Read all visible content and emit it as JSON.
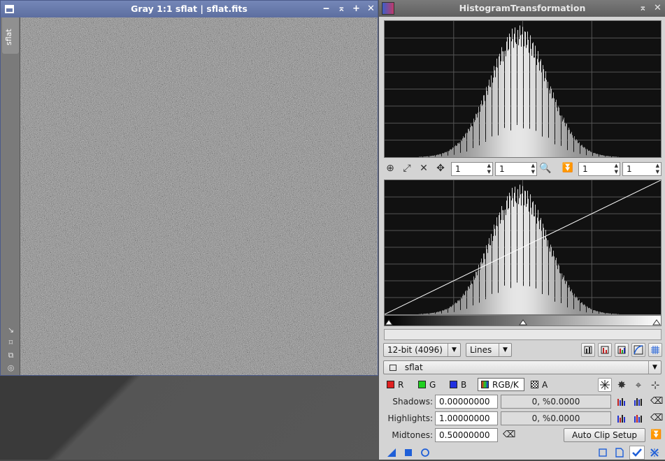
{
  "image_window": {
    "title": "Gray 1:1 sflat | sflat.fits",
    "side_tab_label": "sflat",
    "title_buttons": [
      "minimize",
      "shade",
      "maximize",
      "close"
    ],
    "side_icons": [
      "arrow-diag-icon",
      "fit-icon",
      "clone-icon",
      "mask-icon"
    ]
  },
  "histogram": {
    "title": "HistogramTransformation",
    "zoom_h_top": "1",
    "zoom_v_top": "1",
    "zoom_h_bottom": "1",
    "zoom_v_bottom": "1",
    "resolution": "12-bit (4096)",
    "graph_style": "Lines",
    "view": "sflat",
    "channels": {
      "r": "R",
      "g": "G",
      "b": "B",
      "rgbk": "RGB/K",
      "a": "A"
    },
    "shadows_label": "Shadows:",
    "shadows_value": "0.00000000",
    "shadows_clip": "0, %0.0000",
    "highlights_label": "Highlights:",
    "highlights_value": "1.00000000",
    "highlights_clip": "0, %0.0000",
    "midtones_label": "Midtones:",
    "midtones_value": "0.50000000",
    "auto_clip_label": "Auto Clip Setup"
  },
  "colors": {
    "title_active": "#6b7ba8",
    "panel_bg": "#d4d4d4",
    "graph_bg": "#111111",
    "red": "#e02020",
    "green": "#20d020",
    "blue": "#2030e0"
  }
}
